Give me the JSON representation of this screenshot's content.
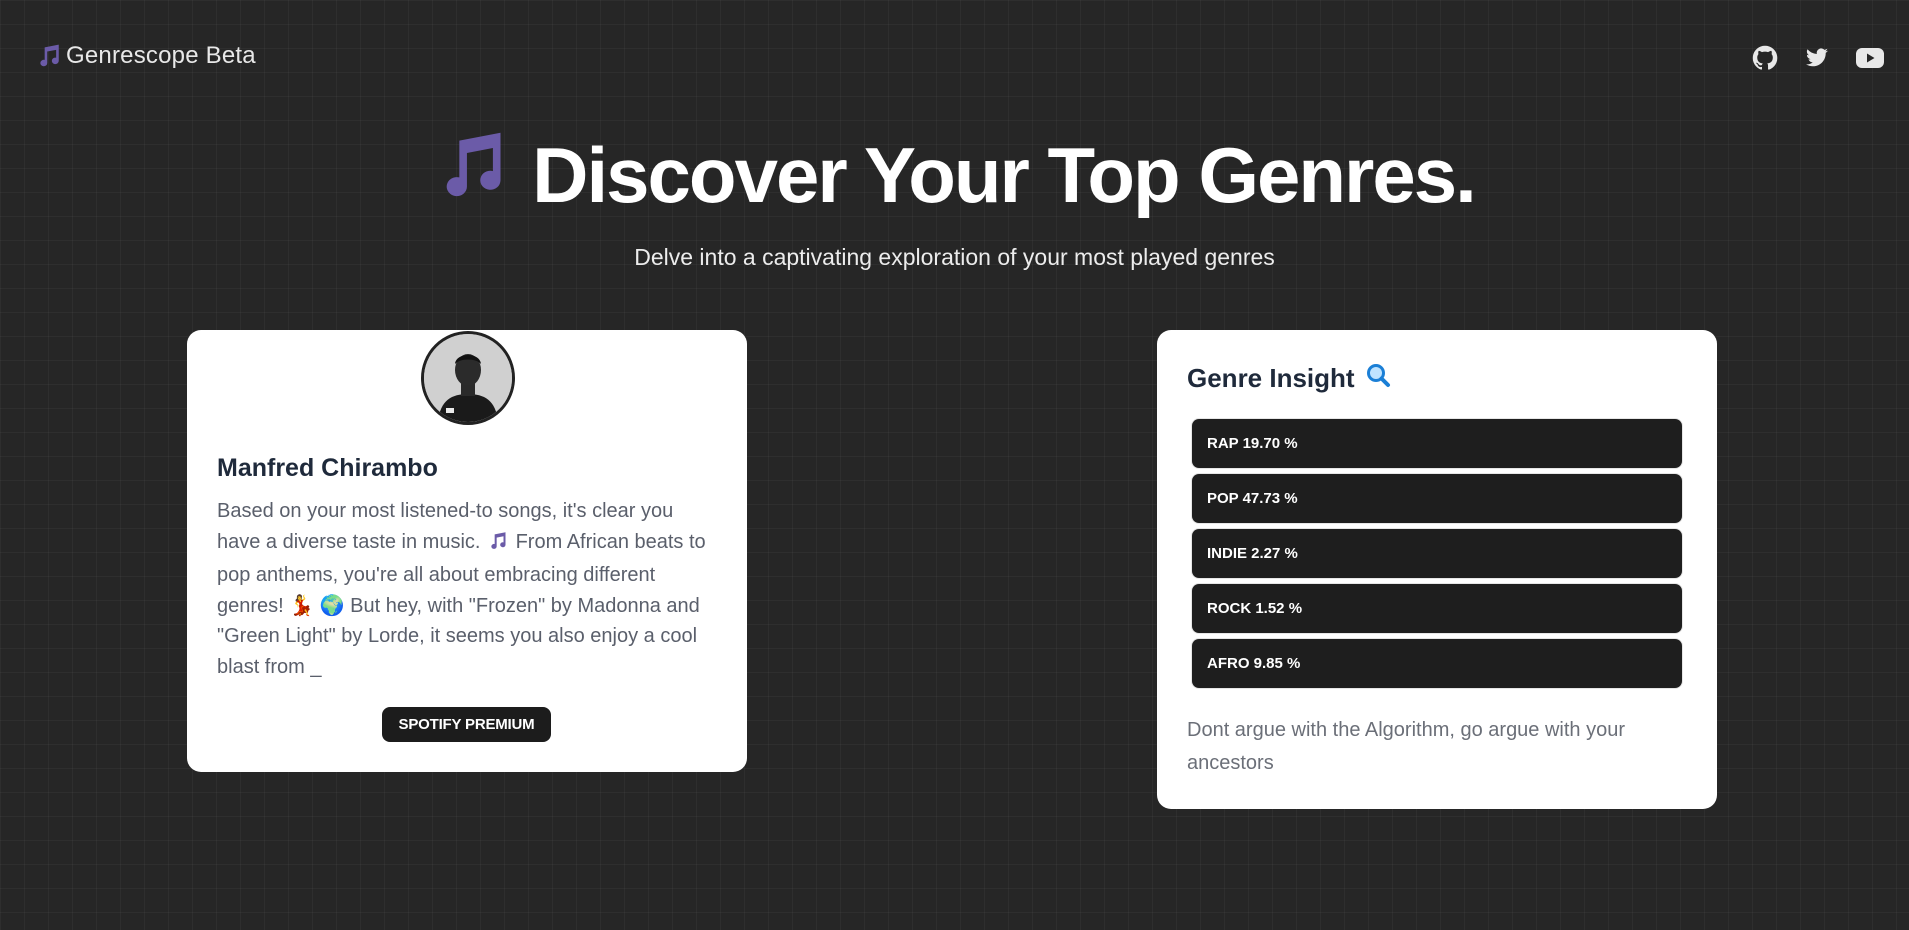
{
  "header": {
    "brand": "Genrescope Beta",
    "brand_icon": "music-note-icon",
    "social": [
      "github-icon",
      "twitter-icon",
      "youtube-icon"
    ]
  },
  "hero": {
    "title": "Discover Your Top Genres.",
    "title_icon": "music-note-icon",
    "subtitle": "Delve into a captivating exploration of your most played genres"
  },
  "profile": {
    "name": "Manfred Chirambo",
    "text_part1": "Based on your most listened-to songs, it's clear you have a diverse taste in music.",
    "text_part2": "From African beats to pop anthems, you're all about embracing different genres! 💃 🌍 But hey, with \"Frozen\" by Madonna and \"Green Light\" by Lorde, it seems you also enjoy a cool blast from",
    "cursor": "_",
    "plan_badge": "SPOTIFY PREMIUM"
  },
  "insight": {
    "title": "Genre Insight",
    "title_icon": "magnifier-icon",
    "genres": [
      {
        "label": "RAP 19.70 %"
      },
      {
        "label": "POP 47.73 %"
      },
      {
        "label": "INDIE 2.27 %"
      },
      {
        "label": "ROCK 1.52 %"
      },
      {
        "label": "AFRO 9.85 %"
      }
    ],
    "footer": "Dont argue with the Algorithm, go argue with your ancestors"
  },
  "colors": {
    "background": "#262626",
    "accent": "#6b5ba8",
    "card": "#ffffff",
    "genre_bar": "#1e1e1e"
  }
}
